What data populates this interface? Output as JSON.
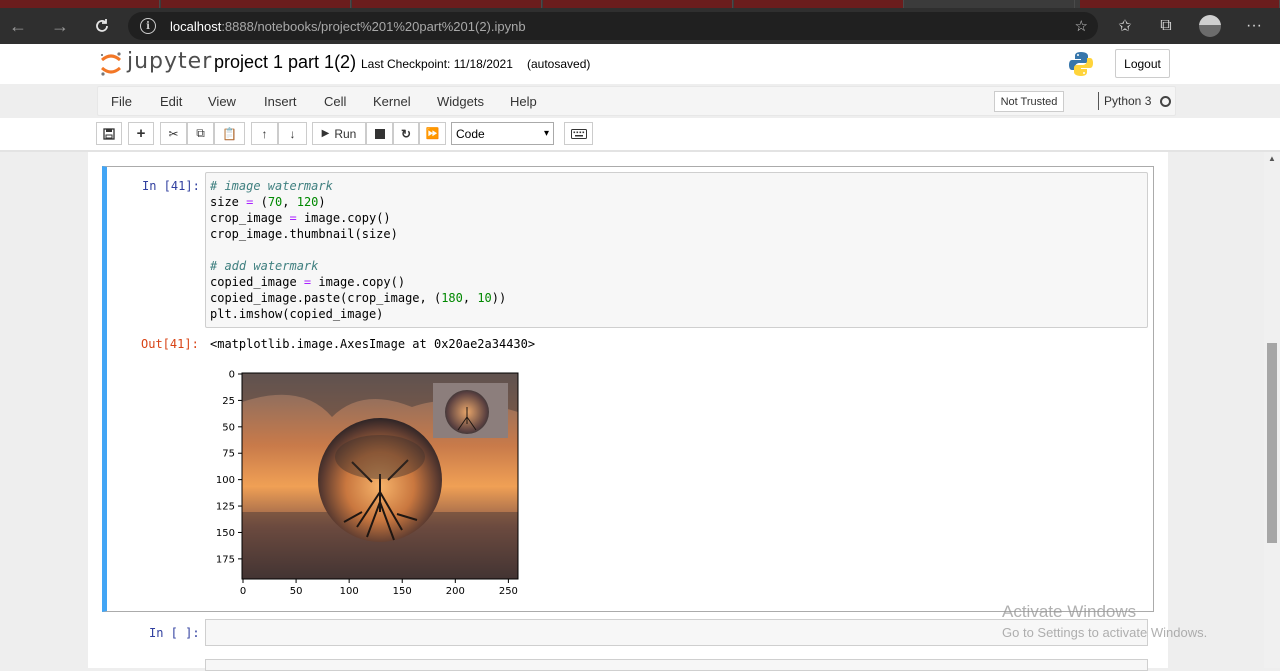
{
  "browser": {
    "url_host": "localhost",
    "url_path": ":8888/notebooks/project%201%20part%201(2).ipynb"
  },
  "header": {
    "logo_text": "jupyter",
    "notebook_title": "project 1 part 1(2)",
    "checkpoint": "Last Checkpoint: 11/18/2021",
    "autosave": "(autosaved)",
    "logout_label": "Logout"
  },
  "menu": {
    "items": [
      "File",
      "Edit",
      "View",
      "Insert",
      "Cell",
      "Kernel",
      "Widgets",
      "Help"
    ],
    "trust_label": "Not Trusted",
    "kernel_name": "Python 3"
  },
  "toolbar": {
    "run_label": "Run",
    "cell_type": "Code"
  },
  "cells": {
    "code_cell": {
      "input_prompt": "In [41]:",
      "output_prompt": "Out[41]:",
      "output_text": "<matplotlib.image.AxesImage at 0x20ae2a34430>"
    },
    "empty_cell": {
      "input_prompt": "In [ ]:"
    }
  },
  "plot": {
    "x_ticks": [
      "0",
      "50",
      "100",
      "150",
      "200",
      "250"
    ],
    "y_ticks": [
      "0",
      "25",
      "50",
      "75",
      "100",
      "125",
      "150",
      "175"
    ]
  },
  "watermark_overlay": {
    "line1": "Activate Windows",
    "line2": "Go to Settings to activate Windows."
  },
  "colors": {
    "selected_cell_border": "#42a5f5",
    "input_prompt": "#303f9f",
    "output_prompt": "#d84315"
  }
}
